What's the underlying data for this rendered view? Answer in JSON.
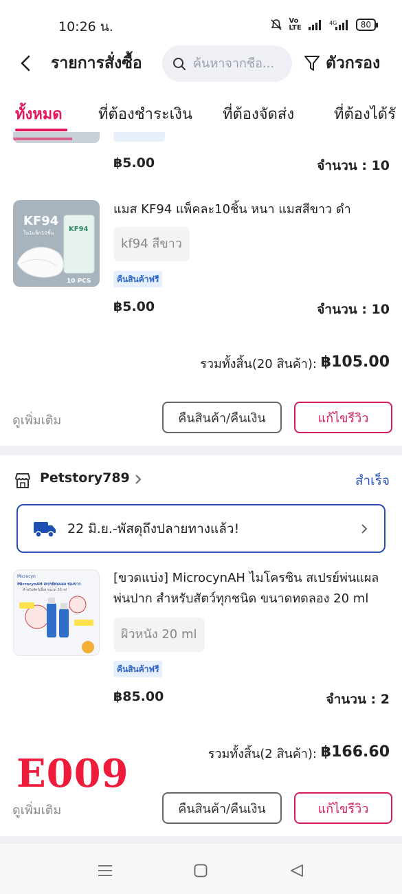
{
  "status_bar": {
    "time": "10:26 น.",
    "battery": "80"
  },
  "header": {
    "title": "รายการสั่งซื้อ",
    "search_placeholder": "ค้นหาจากชื่อ...",
    "filter_label": "ตัวกรอง"
  },
  "tabs": [
    "ทั้งหมด",
    "ที่ต้องชำระเงิน",
    "ที่ต้องจัดส่ง",
    "ที่ต้องได้รั"
  ],
  "order1": {
    "items": [
      {
        "price": "฿5.00",
        "qty": "จำนวน : 10"
      },
      {
        "name": "แมส KF94 แพ็คละ10ชิ้น หนา แมสสีขาว ดำ",
        "variant": "kf94  สีขาว",
        "badge": "คืนสินค้าฟรี",
        "price": "฿5.00",
        "qty": "จำนวน : 10",
        "thumb": {
          "brand": "KF94",
          "sub": "ใน1แพ็ก10ชิ้น",
          "count": "10 PCS"
        }
      }
    ],
    "total_label": "รวมทั้งสิ้น(20 สินค้า):",
    "total_value": "฿105.00",
    "more": "ดูเพิ่มเติม",
    "return_btn": "คืนสินค้า/คืนเงิน",
    "review_btn": "แก้ไขรีวิว"
  },
  "order2": {
    "shop_name": "Petstory789",
    "status": "สำเร็จ",
    "delivery": "22 มิ.ย.-พัสดุถึงปลายทางแล้ว!",
    "item": {
      "name": "[ขวดแบ่ง] MicrocynAH ไมโครซิน สเปรย์พ่นแผล พ่นปาก สำหรับสัตว์ทุกชนิด ขนาดทดลอง 20 ml",
      "variant": "ผิวหนัง 20 ml",
      "badge": "คืนสินค้าฟรี",
      "price": "฿85.00",
      "qty": "จำนวน : 2",
      "thumb": {
        "brand": "Microcyn",
        "headline": "MicrocynAH สเปรย์พ่นแผล ช่องปาก",
        "sub": "สำหรับสัตว์เลี้ยง ขนาด 20 ml"
      }
    },
    "total_label": "รวมทั้งสิ้น(2 สินค้า):",
    "total_value": "฿166.60",
    "more": "ดูเพิ่มเติม",
    "return_btn": "คืนสินค้า/คืนเงิน",
    "review_btn": "แก้ไขรีวิว"
  },
  "watermark": "E009",
  "colors": {
    "accent": "#e0185a",
    "link_blue": "#2453b8",
    "watermark_red": "#ee1b3b"
  },
  "icons": [
    "back-arrow-icon",
    "search-icon",
    "filter-icon",
    "shop-icon",
    "chevron-right-icon",
    "truck-icon",
    "menu-icon",
    "home-icon",
    "back-nav-icon"
  ]
}
